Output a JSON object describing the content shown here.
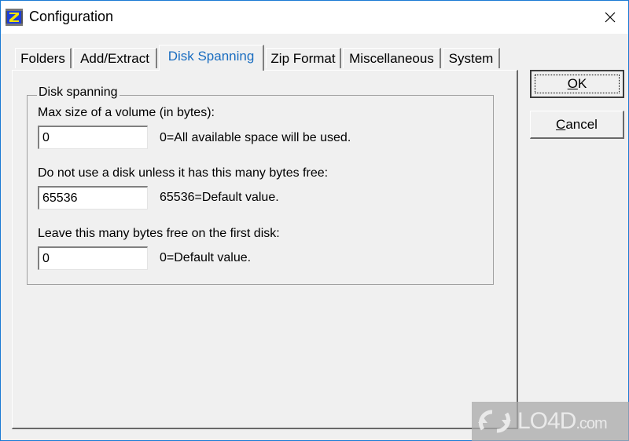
{
  "window": {
    "title": "Configuration",
    "app_icon": "winzip-z-icon",
    "close_icon": "close-x-icon"
  },
  "tabs": [
    {
      "label": "Folders",
      "active": false
    },
    {
      "label": "Add/Extract",
      "active": false
    },
    {
      "label": "Disk Spanning",
      "active": true
    },
    {
      "label": "Zip Format",
      "active": false
    },
    {
      "label": "Miscellaneous",
      "active": false
    },
    {
      "label": "System",
      "active": false
    }
  ],
  "group": {
    "title": "Disk spanning",
    "fields": [
      {
        "label": "Max size of a volume (in bytes):",
        "value": "0",
        "hint": "0=All available space will be used."
      },
      {
        "label": "Do not use a disk unless it has this many bytes free:",
        "value": "65536",
        "hint": "65536=Default value."
      },
      {
        "label": "Leave this many bytes free on the first disk:",
        "value": "0",
        "hint": "0=Default value."
      }
    ]
  },
  "buttons": {
    "ok": {
      "mnemonic": "O",
      "rest": "K"
    },
    "cancel": {
      "mnemonic": "C",
      "rest": "ancel"
    }
  },
  "watermark": {
    "brand": "LO4D",
    "suffix": ".com"
  },
  "colors": {
    "active_tab": "#1a6dc0",
    "window_border": "#1a7ad4"
  }
}
